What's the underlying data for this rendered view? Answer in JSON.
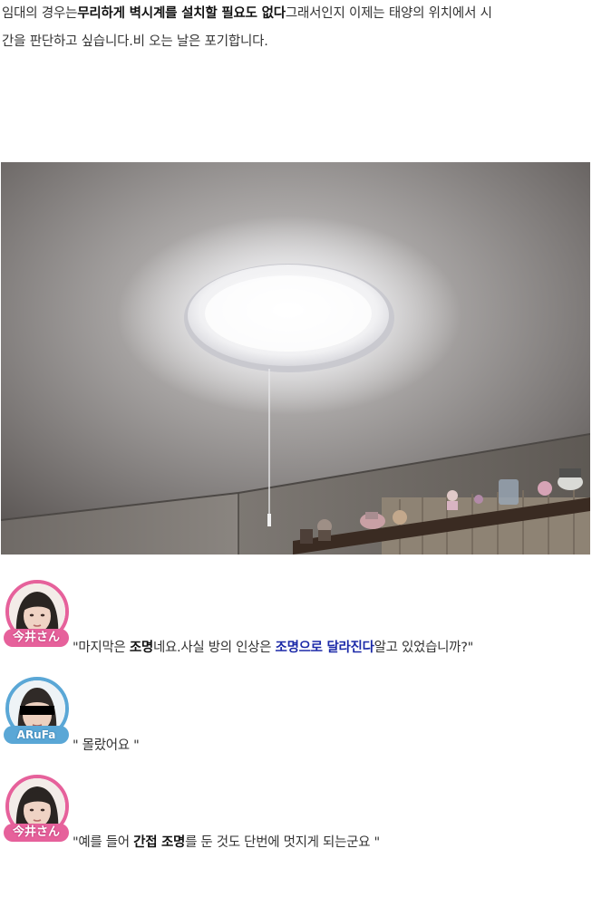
{
  "intro": {
    "line1_a": "임대의 경우는",
    "line1_b": "무리하게 벽시계를 설치할 필요도 없다",
    "line1_c": "그래서인지 이제는 태양의 위치에서 시",
    "line2": "간을 판단하고 싶습니다.비 오는 날은 포기합니다."
  },
  "photo": {
    "subject": "ceiling-light-photo"
  },
  "chats": [
    {
      "avatar_tag": "今井さん",
      "parts": [
        "\"마지막은 ",
        "조명",
        "네요.사실 방의 인상은 ",
        "조명으로 달라진다",
        "알고 있었습니까?\""
      ]
    },
    {
      "avatar_tag": "ARuFa",
      "text": "\" 몰랐어요 \""
    },
    {
      "avatar_tag": "今井さん",
      "parts": [
        "\"예를 들어 ",
        "간접 조명",
        "를 둔 것도 단번에 멋지게 되는군요 \""
      ]
    }
  ]
}
